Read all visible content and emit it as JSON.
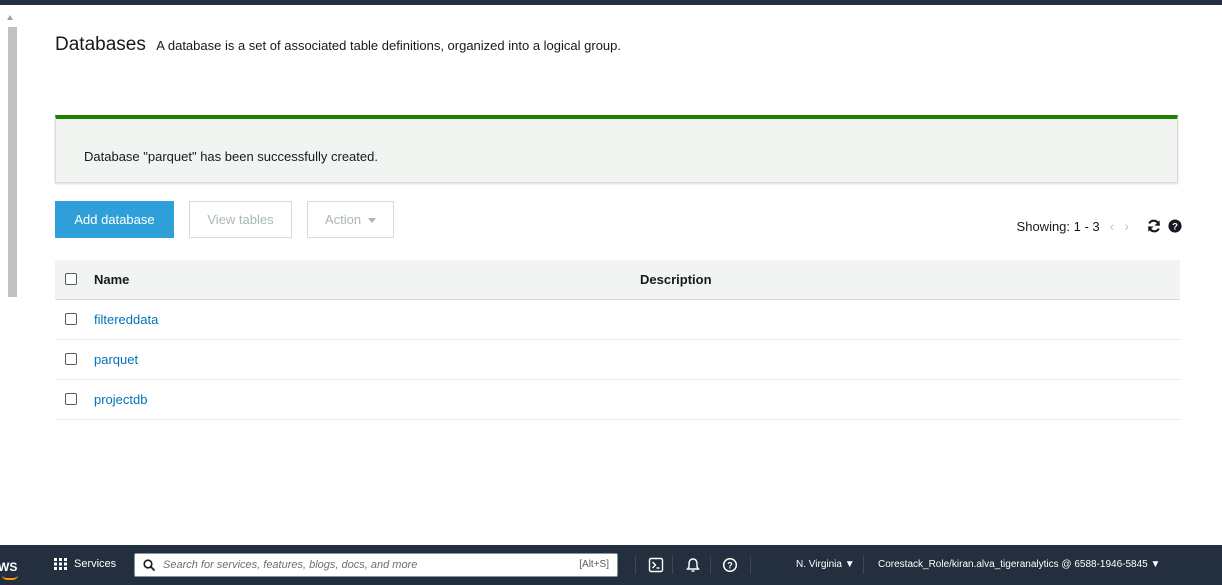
{
  "page": {
    "title": "Databases",
    "description": "A database is a set of associated table definitions, organized into a logical group."
  },
  "flash": {
    "message": "Database \"parquet\" has been successfully created."
  },
  "toolbar": {
    "add_label": "Add database",
    "view_label": "View tables",
    "action_label": "Action",
    "showing": "Showing: 1 - 3"
  },
  "icons": {
    "prev": "chevron-left-icon",
    "next": "chevron-right-icon",
    "refresh": "refresh-icon",
    "help": "help-icon"
  },
  "table": {
    "columns": [
      "Name",
      "Description"
    ],
    "rows": [
      {
        "name": "filtereddata",
        "description": ""
      },
      {
        "name": "parquet",
        "description": ""
      },
      {
        "name": "projectdb",
        "description": ""
      }
    ]
  },
  "console_bar": {
    "logo": "WS",
    "services_label": "Services",
    "search_placeholder": "Search for services, features, blogs, docs, and more",
    "search_shortcut": "[Alt+S]",
    "region": "N. Virginia ▼",
    "account": "Corestack_Role/kiran.alva_tigeranalytics @ 6588-1946-5845 ▼"
  },
  "colors": {
    "primary": "#2e9fd8",
    "success": "#1d8102",
    "link": "#0073bb",
    "nav_dark": "#232f3e"
  }
}
